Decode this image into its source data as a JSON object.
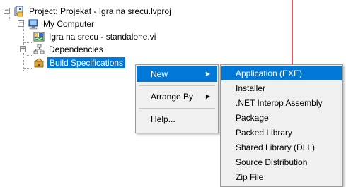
{
  "tree": {
    "project_label": "Project: Projekat - Igra na srecu.lvproj",
    "computer_label": "My Computer",
    "vi_label": "Igra na srecu - standalone.vi",
    "dependencies_label": "Dependencies",
    "build_specs_label": "Build Specifications"
  },
  "context_menu": {
    "items": [
      {
        "label": "New",
        "has_submenu": true
      },
      {
        "label": "Arrange By",
        "has_submenu": true
      },
      {
        "label": "Help...",
        "has_submenu": false
      }
    ]
  },
  "submenu": {
    "items": [
      {
        "label": "Application (EXE)"
      },
      {
        "label": "Installer"
      },
      {
        "label": ".NET Interop Assembly"
      },
      {
        "label": "Package"
      },
      {
        "label": "Packed Library"
      },
      {
        "label": "Shared Library (DLL)"
      },
      {
        "label": "Source Distribution"
      },
      {
        "label": "Zip File"
      }
    ]
  },
  "colors": {
    "selection": "#0078d7",
    "menu_bg": "#f0f0f0",
    "splitter": "#e15b5b"
  },
  "icons": {
    "project": "project-icon",
    "computer": "computer-icon",
    "vi": "vi-file-icon",
    "dependencies": "dependencies-icon",
    "build_specs": "build-specifications-icon",
    "submenu_arrow": "chevron-right-icon"
  }
}
